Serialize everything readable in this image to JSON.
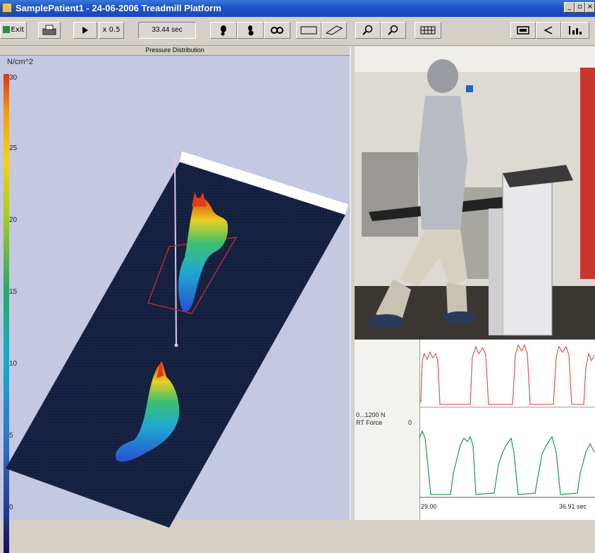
{
  "window": {
    "title": "SamplePatient1 - 24-06-2006 Treadmill Platform"
  },
  "toolbar": {
    "exit_label": "Exit",
    "speed_label": "x 0.5",
    "time_display": "33.44 sec"
  },
  "pressure": {
    "pane_title": "Pressure Distribution",
    "unit_label": "N/cm^2",
    "scale_ticks": [
      "30",
      "25",
      "20",
      "15",
      "10",
      "5",
      "0"
    ]
  },
  "force": {
    "range_label": "0...1200 N",
    "series_label": "RT Force",
    "zero_label": "0",
    "x_start": "29.00",
    "x_end": "36.91 sec"
  },
  "colors": {
    "titlebar": "#1e54c8",
    "toolbar": "#d4d0c8",
    "pressure_bg": "#c4c8e0",
    "plate": "#14203e",
    "force_top": "#e06060",
    "force_bottom": "#2aa060",
    "selection": "#d02828"
  }
}
